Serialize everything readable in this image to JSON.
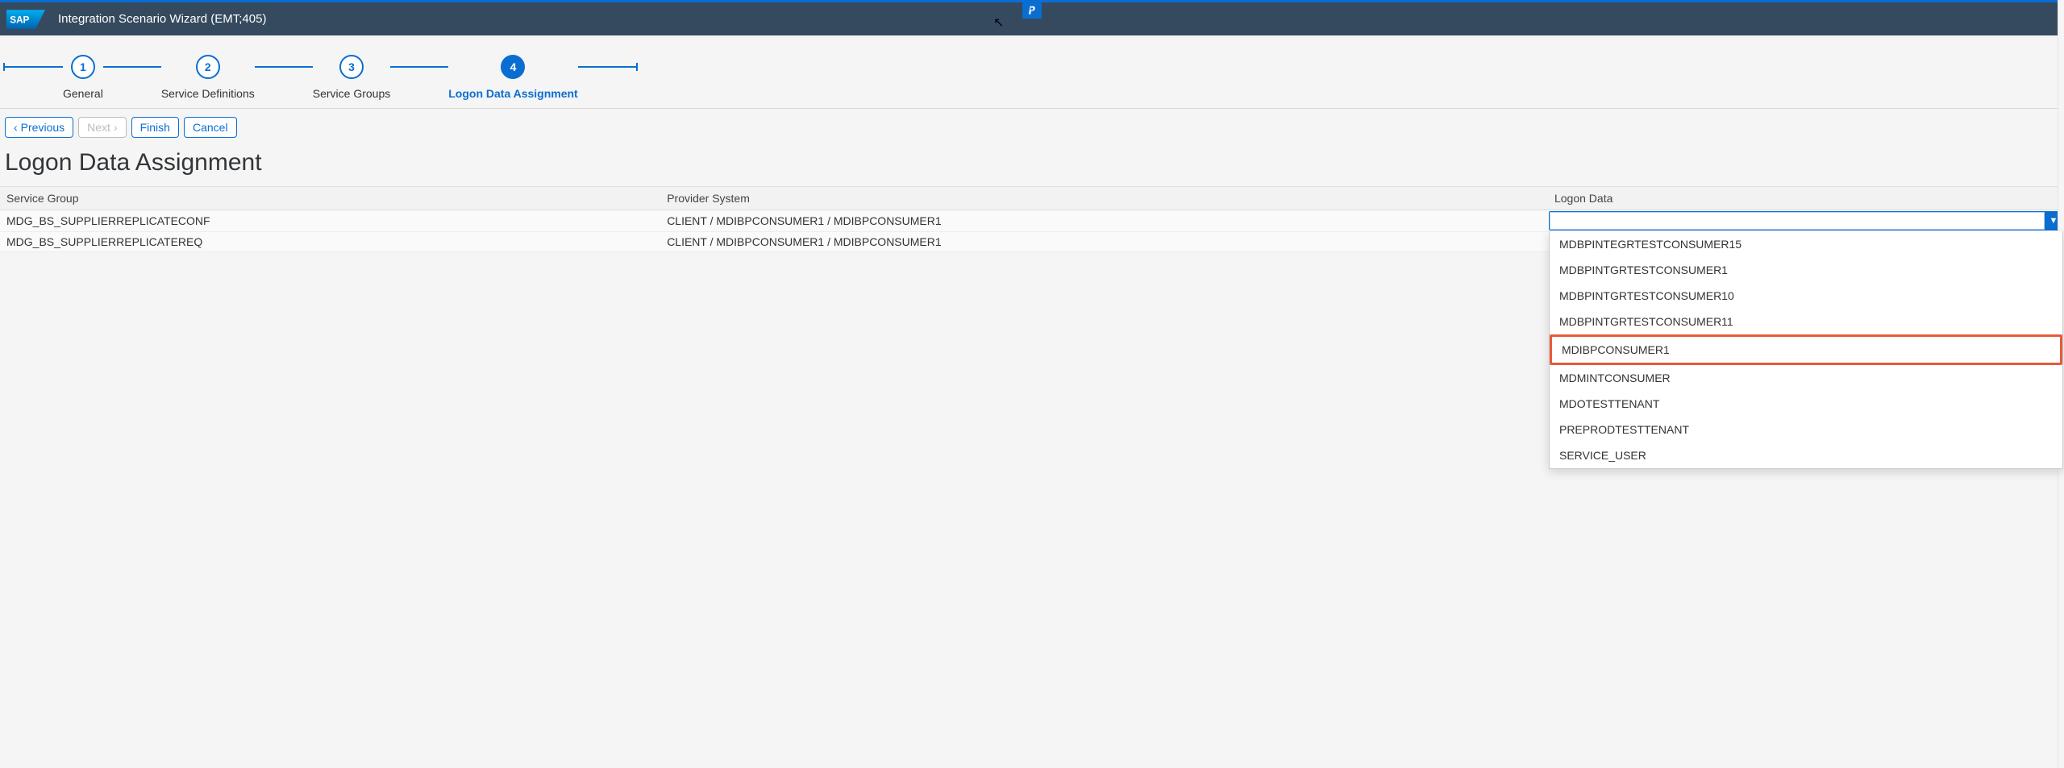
{
  "header": {
    "title": "Integration Scenario Wizard (EMT;405)"
  },
  "wizard": {
    "steps": [
      {
        "num": "1",
        "label": "General"
      },
      {
        "num": "2",
        "label": "Service Definitions"
      },
      {
        "num": "3",
        "label": "Service Groups"
      },
      {
        "num": "4",
        "label": "Logon Data Assignment",
        "active": true
      }
    ]
  },
  "toolbar": {
    "previous": "Previous",
    "next": "Next",
    "finish": "Finish",
    "cancel": "Cancel"
  },
  "page": {
    "title": "Logon Data Assignment"
  },
  "table": {
    "columns": {
      "service_group": "Service Group",
      "provider_system": "Provider System",
      "logon_data": "Logon Data"
    },
    "rows": [
      {
        "service_group": "MDG_BS_SUPPLIERREPLICATECONF",
        "provider_system": "CLIENT / MDIBPCONSUMER1 / MDIBPCONSUMER1",
        "logon_value": ""
      },
      {
        "service_group": "MDG_BS_SUPPLIERREPLICATEREQ",
        "provider_system": "CLIENT / MDIBPCONSUMER1 / MDIBPCONSUMER1",
        "logon_value": ""
      }
    ]
  },
  "dropdown": {
    "options": [
      "MDBPINTEGRTESTCONSUMER15",
      "MDBPINTGRTESTCONSUMER1",
      "MDBPINTGRTESTCONSUMER10",
      "MDBPINTGRTESTCONSUMER11",
      "MDIBPCONSUMER1",
      "MDMINTCONSUMER",
      "MDOTESTTENANT",
      "PREPRODTESTTENANT",
      "SERVICE_USER"
    ],
    "highlight_index": 4
  }
}
